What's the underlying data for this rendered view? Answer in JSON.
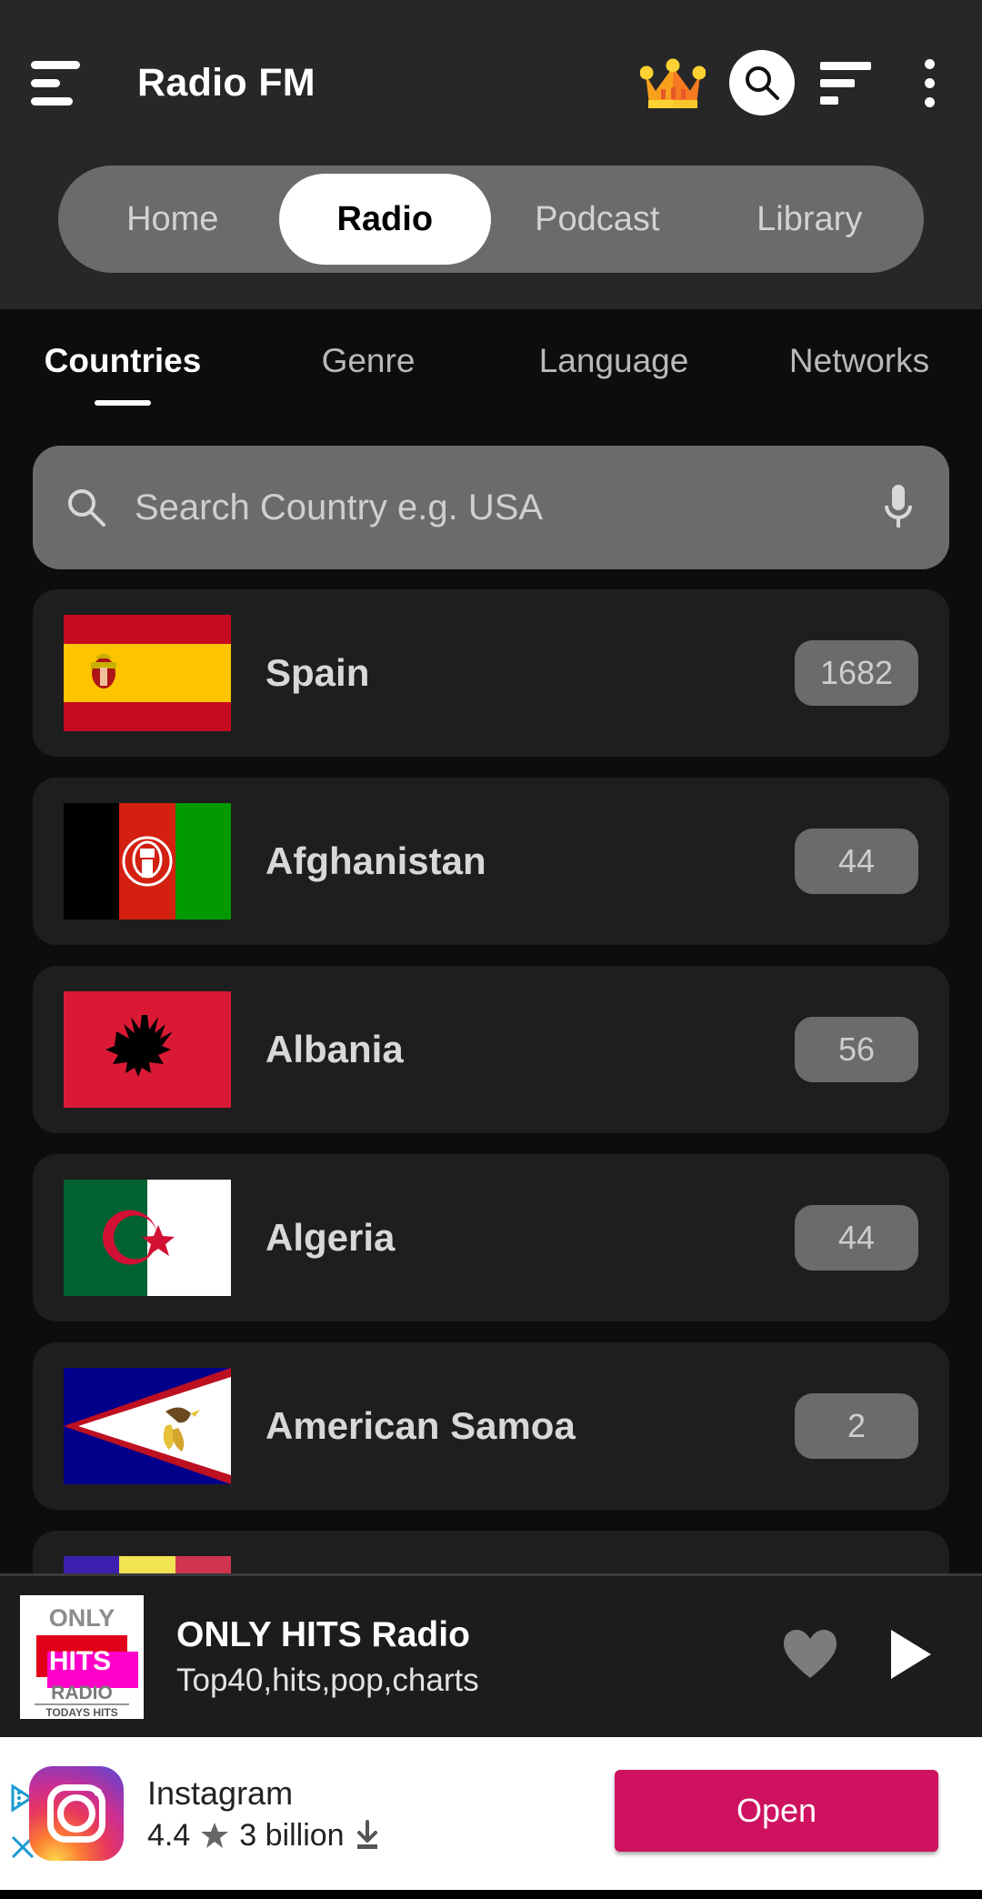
{
  "appbar": {
    "title": "Radio FM",
    "menu_icon": "hamburger-icon",
    "premium_icon": "crown-icon",
    "search_icon": "search-icon",
    "sort_icon": "sort-descending-icon",
    "overflow_icon": "more-vertical-icon"
  },
  "segment": {
    "items": [
      {
        "label": "Home",
        "active": false
      },
      {
        "label": "Radio",
        "active": true
      },
      {
        "label": "Podcast",
        "active": false
      },
      {
        "label": "Library",
        "active": false
      }
    ]
  },
  "subtabs": {
    "items": [
      {
        "label": "Countries",
        "active": true
      },
      {
        "label": "Genre",
        "active": false
      },
      {
        "label": "Language",
        "active": false
      },
      {
        "label": "Networks",
        "active": false
      }
    ]
  },
  "search": {
    "placeholder": "Search Country e.g. USA",
    "value": "",
    "leading_icon": "search-icon",
    "trailing_icon": "microphone-icon"
  },
  "countries": [
    {
      "name": "Spain",
      "count": "1682",
      "flag": "spain"
    },
    {
      "name": "Afghanistan",
      "count": "44",
      "flag": "afghanistan"
    },
    {
      "name": "Albania",
      "count": "56",
      "flag": "albania"
    },
    {
      "name": "Algeria",
      "count": "44",
      "flag": "algeria"
    },
    {
      "name": "American Samoa",
      "count": "2",
      "flag": "american-samoa"
    },
    {
      "name": "",
      "count": "",
      "flag": "andorra"
    }
  ],
  "now_playing": {
    "title": "ONLY HITS Radio",
    "subtitle": "Top40,hits,pop,charts",
    "artwork_line1": "ONLY",
    "artwork_line2": "HITS",
    "artwork_line3": "RADIO",
    "artwork_line4": "TODAYS HITS",
    "favorite_icon": "heart-icon",
    "play_icon": "play-icon"
  },
  "ad": {
    "app_name": "Instagram",
    "rating": "4.4",
    "star_icon": "star-icon",
    "installs": "3 billion",
    "download_icon": "download-icon",
    "cta_label": "Open",
    "cta_color": "#ce1260",
    "adchoices_icon": "adchoices-icon",
    "close_icon": "close-icon"
  }
}
